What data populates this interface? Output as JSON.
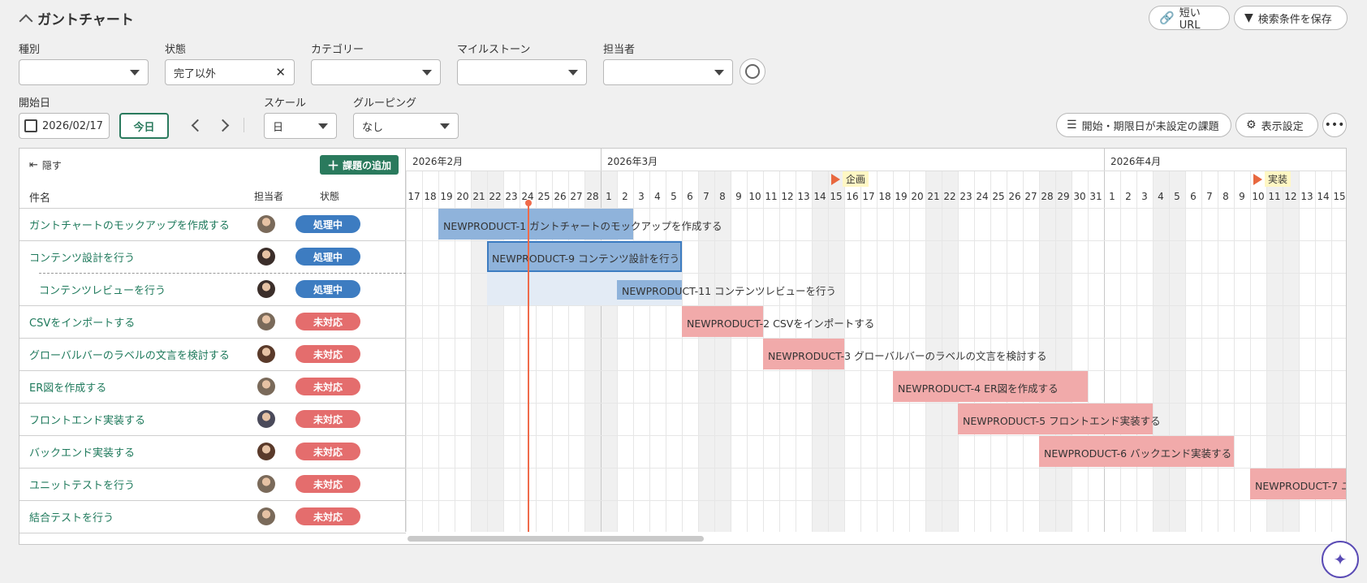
{
  "header": {
    "title": "ガントチャート",
    "short_url": "短いURL",
    "save_filter": "検索条件を保存"
  },
  "filters": {
    "type_label": "種別",
    "status_label": "状態",
    "status_value": "完了以外",
    "category_label": "カテゴリー",
    "milestone_label": "マイルストーン",
    "assignee_label": "担当者"
  },
  "controls": {
    "start_label": "開始日",
    "start_value": "2026/02/17",
    "today": "今日",
    "scale_label": "スケール",
    "scale_value": "日",
    "grouping_label": "グルーピング",
    "grouping_value": "なし",
    "unscheduled": "開始・期限日が未設定の課題",
    "display_settings": "表示設定"
  },
  "list": {
    "hide": "隠す",
    "add_issue": "課題の追加",
    "col_name": "件名",
    "col_assignee": "担当者",
    "col_status": "状態",
    "rows": [
      {
        "name": "ガントチャートのモックアップを作成する",
        "status": "処理中",
        "kind": "proc",
        "avatar_color": "#7a6a5a"
      },
      {
        "name": "コンテンツ設計を行う",
        "status": "処理中",
        "kind": "proc",
        "avatar_color": "#3b2e2a"
      },
      {
        "name": "コンテンツレビューを行う",
        "status": "処理中",
        "kind": "proc",
        "avatar_color": "#3b2e2a"
      },
      {
        "name": "CSVをインポートする",
        "status": "未対応",
        "kind": "open",
        "avatar_color": "#7a6a5a"
      },
      {
        "name": "グローバルバーのラベルの文言を検討する",
        "status": "未対応",
        "kind": "open",
        "avatar_color": "#5a3a2a"
      },
      {
        "name": "ER図を作成する",
        "status": "未対応",
        "kind": "open",
        "avatar_color": "#7a6a5a"
      },
      {
        "name": "フロントエンド実装する",
        "status": "未対応",
        "kind": "open",
        "avatar_color": "#4a4a5a"
      },
      {
        "name": "バックエンド実装する",
        "status": "未対応",
        "kind": "open",
        "avatar_color": "#5a3a2a"
      },
      {
        "name": "ユニットテストを行う",
        "status": "未対応",
        "kind": "open",
        "avatar_color": "#7a6a5a"
      },
      {
        "name": "結合テストを行う",
        "status": "未対応",
        "kind": "open",
        "avatar_color": "#7a6a5a"
      }
    ]
  },
  "gantt": {
    "months": [
      {
        "label": "2026年2月",
        "start": 0
      },
      {
        "label": "2026年3月",
        "start": 12
      },
      {
        "label": "2026年4月",
        "start": 43
      }
    ],
    "days": [
      "17",
      "18",
      "19",
      "20",
      "21",
      "22",
      "23",
      "24",
      "25",
      "26",
      "27",
      "28",
      "1",
      "2",
      "3",
      "4",
      "5",
      "6",
      "7",
      "8",
      "9",
      "10",
      "11",
      "12",
      "13",
      "14",
      "15",
      "16",
      "17",
      "18",
      "19",
      "20",
      "21",
      "22",
      "23",
      "24",
      "25",
      "26",
      "27",
      "28",
      "29",
      "30",
      "31",
      "1",
      "2",
      "3",
      "4",
      "5",
      "6",
      "7",
      "8",
      "9",
      "10",
      "11",
      "12",
      "13",
      "14",
      "15"
    ],
    "weekends": [
      4,
      5,
      11,
      12,
      18,
      19,
      25,
      26,
      32,
      33,
      39,
      40,
      46,
      47,
      53,
      54
    ],
    "today_index": 7,
    "milestones": [
      {
        "label": "企画",
        "day": 26
      },
      {
        "label": "実装",
        "day": 52
      }
    ],
    "bars": [
      {
        "row": 0,
        "start": 2,
        "len": 12,
        "color": "blue",
        "key": "NEWPRODUCT-1",
        "title": "ガントチャートのモックアップを作成する",
        "inside": true
      },
      {
        "row": 1,
        "start": 5,
        "len": 12,
        "color": "blue",
        "key": "NEWPRODUCT-9",
        "title": "コンテンツ設計を行う",
        "inside": true
      },
      {
        "row": 2,
        "start": 13,
        "len": 4,
        "color": "blue",
        "key": "NEWPRODUCT-11",
        "title": "コンテンツレビューを行う",
        "inside": false
      },
      {
        "row": 3,
        "start": 17,
        "len": 5,
        "color": "red",
        "key": "NEWPRODUCT-2",
        "title": "CSVをインポートする",
        "inside": false
      },
      {
        "row": 4,
        "start": 22,
        "len": 5,
        "color": "red",
        "key": "NEWPRODUCT-3",
        "title": "グローバルバーのラベルの文言を検討する",
        "inside": false
      },
      {
        "row": 5,
        "start": 30,
        "len": 12,
        "color": "red",
        "key": "NEWPRODUCT-4",
        "title": "ER図を作成する",
        "inside": true
      },
      {
        "row": 6,
        "start": 34,
        "len": 12,
        "color": "red",
        "key": "NEWPRODUCT-5",
        "title": "フロントエンド実装する",
        "inside": true
      },
      {
        "row": 7,
        "start": 39,
        "len": 12,
        "color": "red",
        "key": "NEWPRODUCT-6",
        "title": "バックエンド実装する",
        "inside": true
      },
      {
        "row": 8,
        "start": 52,
        "len": 6,
        "color": "red",
        "key": "NEWPRODUCT-7",
        "title": "ユ",
        "inside": true
      }
    ]
  }
}
